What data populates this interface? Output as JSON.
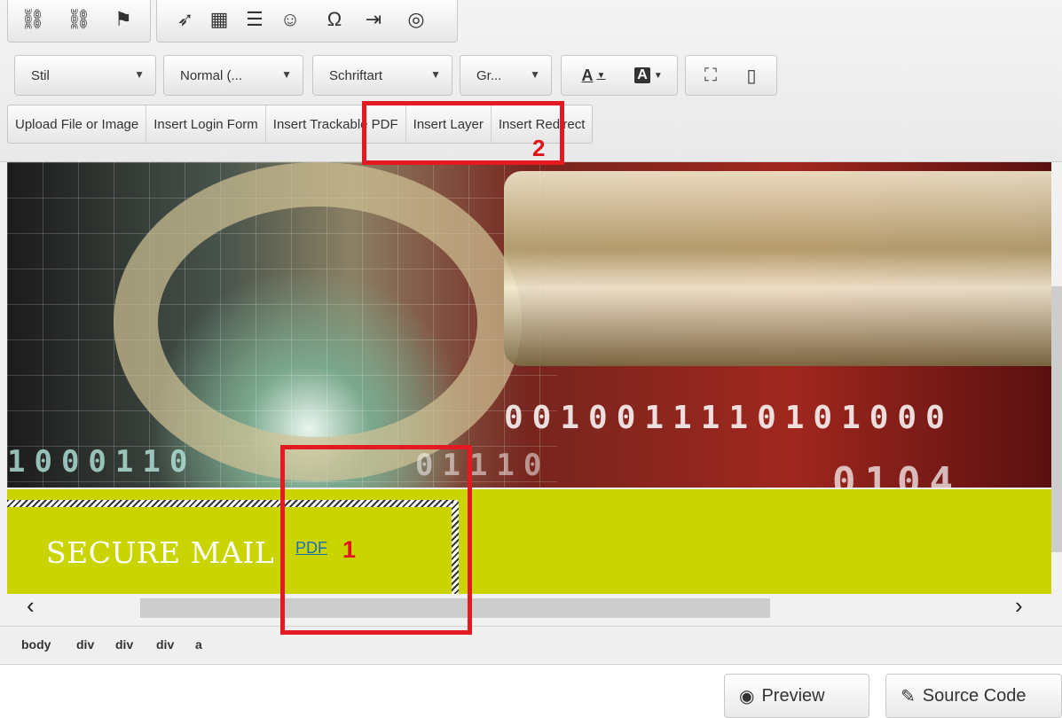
{
  "toolbar": {
    "row1_icons": [
      "link-icon",
      "unlink-icon",
      "anchor-flag-icon",
      "flash-icon",
      "table-icon",
      "horizontal-rule-icon",
      "smiley-icon",
      "omega-icon",
      "page-break-icon",
      "globe-icon"
    ],
    "row1_glyphs": [
      "⛓",
      "⛓",
      "⚑",
      "➶",
      "▦",
      "☰",
      "☺",
      "Ω",
      "⇥",
      "◎"
    ],
    "combos": [
      {
        "label": "Stil"
      },
      {
        "label": "Normal (..."
      },
      {
        "label": "Schriftart"
      },
      {
        "label": "Gr..."
      }
    ],
    "text_color_glyph": "A",
    "bg_color_glyph": "A",
    "maximize_glyph": "⛶",
    "showblocks_glyph": "▯",
    "insert_buttons": [
      "Upload File or Image",
      "Insert Login Form",
      "Insert Trackable PDF",
      "Insert Layer",
      "Insert Redirect"
    ]
  },
  "content": {
    "binary_row1": "0010011110101000",
    "binary_row2": "1000110",
    "binary_row3": "01110",
    "binary_row4": "0104",
    "banner_text": "SECURE MAIL",
    "pdf_link": "PDF"
  },
  "annotations": {
    "marker1": "1",
    "marker2": "2",
    "color": "#e41a22"
  },
  "statusbar": {
    "path": [
      "body",
      "div",
      "div",
      "div",
      "a"
    ]
  },
  "actions": {
    "preview_label": "Preview",
    "source_label": "Source Code"
  },
  "colors": {
    "band": "#c9d400",
    "link": "#1d6fb8"
  }
}
